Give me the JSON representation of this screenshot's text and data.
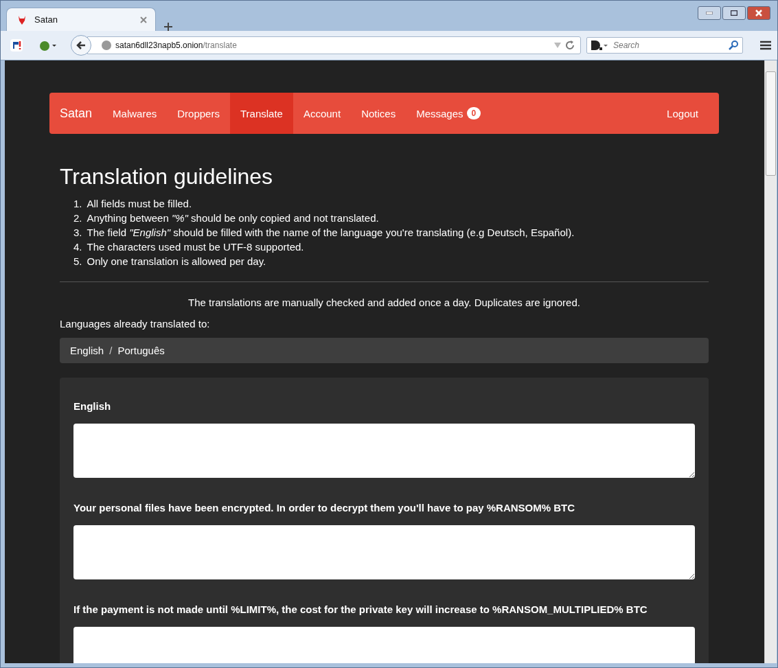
{
  "browser": {
    "tab_title": "Satan",
    "url_host": "satan6dll23napb5.onion",
    "url_path": "/translate",
    "search_placeholder": "Search"
  },
  "navbar": {
    "brand": "Satan",
    "items": [
      {
        "label": "Malwares",
        "selected": false
      },
      {
        "label": "Droppers",
        "selected": false
      },
      {
        "label": "Translate",
        "selected": true
      },
      {
        "label": "Account",
        "selected": false
      },
      {
        "label": "Notices",
        "selected": false
      },
      {
        "label": "Messages",
        "selected": false,
        "badge": "0"
      }
    ],
    "right_item": "Logout"
  },
  "heading": "Translation guidelines",
  "guidelines": [
    {
      "number": "1.",
      "text": "All fields must be filled."
    },
    {
      "number": "2.",
      "text": "Anything between *\"%\"* should be only copied and not translated."
    },
    {
      "number": "3.",
      "text": "The field *\"English\"* should be filled with the name of the language you're translating (e.g Deutsch, Español)."
    },
    {
      "number": "4.",
      "text": "The characters used must be UTF-8 supported."
    },
    {
      "number": "5.",
      "text": "Only one translation is allowed per day."
    }
  ],
  "notice": "The translations are manually checked and added once a day. Duplicates are ignored.",
  "languages_label": "Languages already translated to:",
  "languages": {
    "items": [
      "English",
      "Português"
    ],
    "separator": "/"
  },
  "form": {
    "fields": [
      {
        "label": "English"
      },
      {
        "label": "Your personal files have been encrypted. In order to decrypt them you'll have to pay %RANSOM% BTC"
      },
      {
        "label": "If the payment is not made until %LIMIT%, the cost for the private key will increase to %RANSOM_MULTIPLIED% BTC"
      }
    ]
  }
}
